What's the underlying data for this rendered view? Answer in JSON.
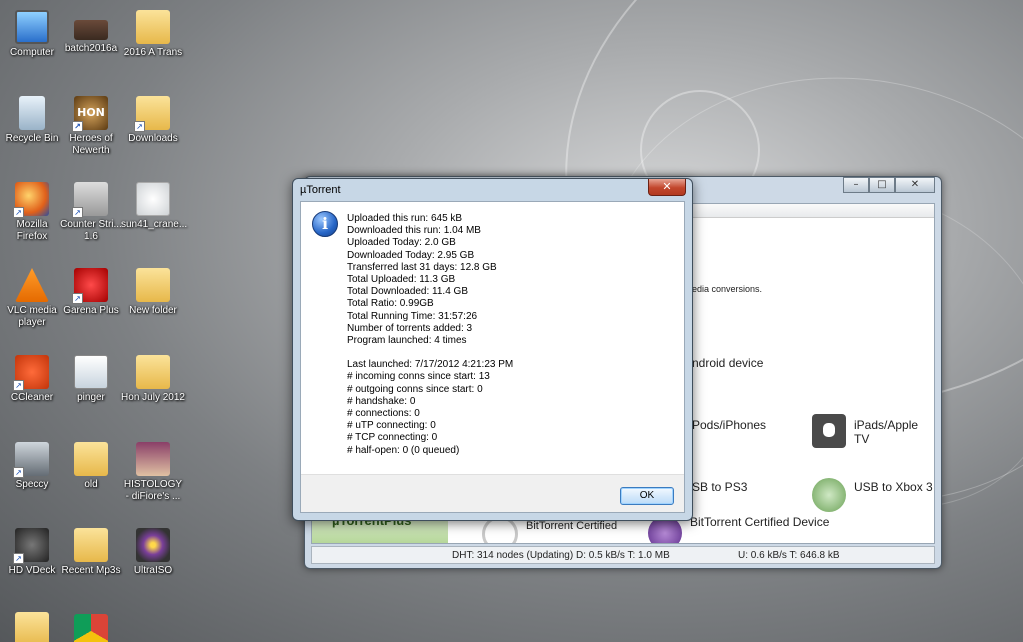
{
  "desktop": {
    "icons": [
      {
        "label": "Computer",
        "icon": "computer-icon"
      },
      {
        "label": "batch2016a",
        "icon": "image-icon"
      },
      {
        "label": "2016 A Trans",
        "icon": "folder-icon"
      },
      {
        "label": "Recycle Bin",
        "icon": "recycle-bin-icon"
      },
      {
        "label": "Heroes of Newerth",
        "icon": "hon-icon"
      },
      {
        "label": "Downloads",
        "icon": "downloads-folder-icon"
      },
      {
        "label": "Mozilla Firefox",
        "icon": "firefox-icon"
      },
      {
        "label": "Counter Stri... 1.6",
        "icon": "counter-strike-icon"
      },
      {
        "label": "sun41_crane...",
        "icon": "cd-file-icon"
      },
      {
        "label": "VLC media player",
        "icon": "vlc-icon"
      },
      {
        "label": "Garena Plus",
        "icon": "garena-icon"
      },
      {
        "label": "New folder",
        "icon": "folder-icon"
      },
      {
        "label": "CCleaner",
        "icon": "ccleaner-icon"
      },
      {
        "label": "pinger",
        "icon": "pinger-icon"
      },
      {
        "label": "Hon July 2012",
        "icon": "folder-icon"
      },
      {
        "label": "Speccy",
        "icon": "speccy-icon"
      },
      {
        "label": "old",
        "icon": "folder-icon"
      },
      {
        "label": "HISTOLOGY - diFiore's ...",
        "icon": "document-icon"
      },
      {
        "label": "HD VDeck",
        "icon": "hd-vdeck-icon"
      },
      {
        "label": "Recent Mp3s",
        "icon": "folder-icon"
      },
      {
        "label": "UltraISO",
        "icon": "ultraiso-icon"
      }
    ]
  },
  "bg_window": {
    "content": {
      "conversions_text": "edia conversions.",
      "android": "ndroid device",
      "ipods": "Pods/iPhones",
      "ipads": "iPads/Apple TV",
      "ps3": "SB to PS3",
      "xbox": "USB to Xbox 3",
      "plus_label": "µTorrentPlus",
      "certified": "BitTorrent Certified",
      "certified_device": "BitTorrent Certified Device"
    },
    "status": {
      "dht": "DHT: 314 nodes (Updating)",
      "download": "D: 0.5 kB/s T: 1.0 MB",
      "upload": "U: 0.6 kB/s T: 646.8 kB"
    }
  },
  "dialog": {
    "title": "µTorrent",
    "stats": [
      "Uploaded this run: 645 kB",
      "Downloaded this run: 1.04 MB",
      "Uploaded Today: 2.0 GB",
      "Downloaded Today: 2.95 GB",
      "Transferred last 31 days: 12.8 GB",
      "Total Uploaded: 11.3  GB",
      "Total Downloaded: 11.4 GB",
      "Total Ratio: 0.99GB",
      "Total Running Time: 31:57:26",
      "Number of torrents added: 3",
      "Program launched: 4 times",
      "",
      "Last launched: 7/17/2012 4:21:23 PM",
      "# incoming conns since start: 13",
      "# outgoing conns since start: 0",
      "# handshake: 0",
      "# connections: 0",
      "# uTP connecting: 0",
      "# TCP connecting: 0",
      "# half-open: 0 (0 queued)"
    ],
    "ok_label": "OK"
  }
}
